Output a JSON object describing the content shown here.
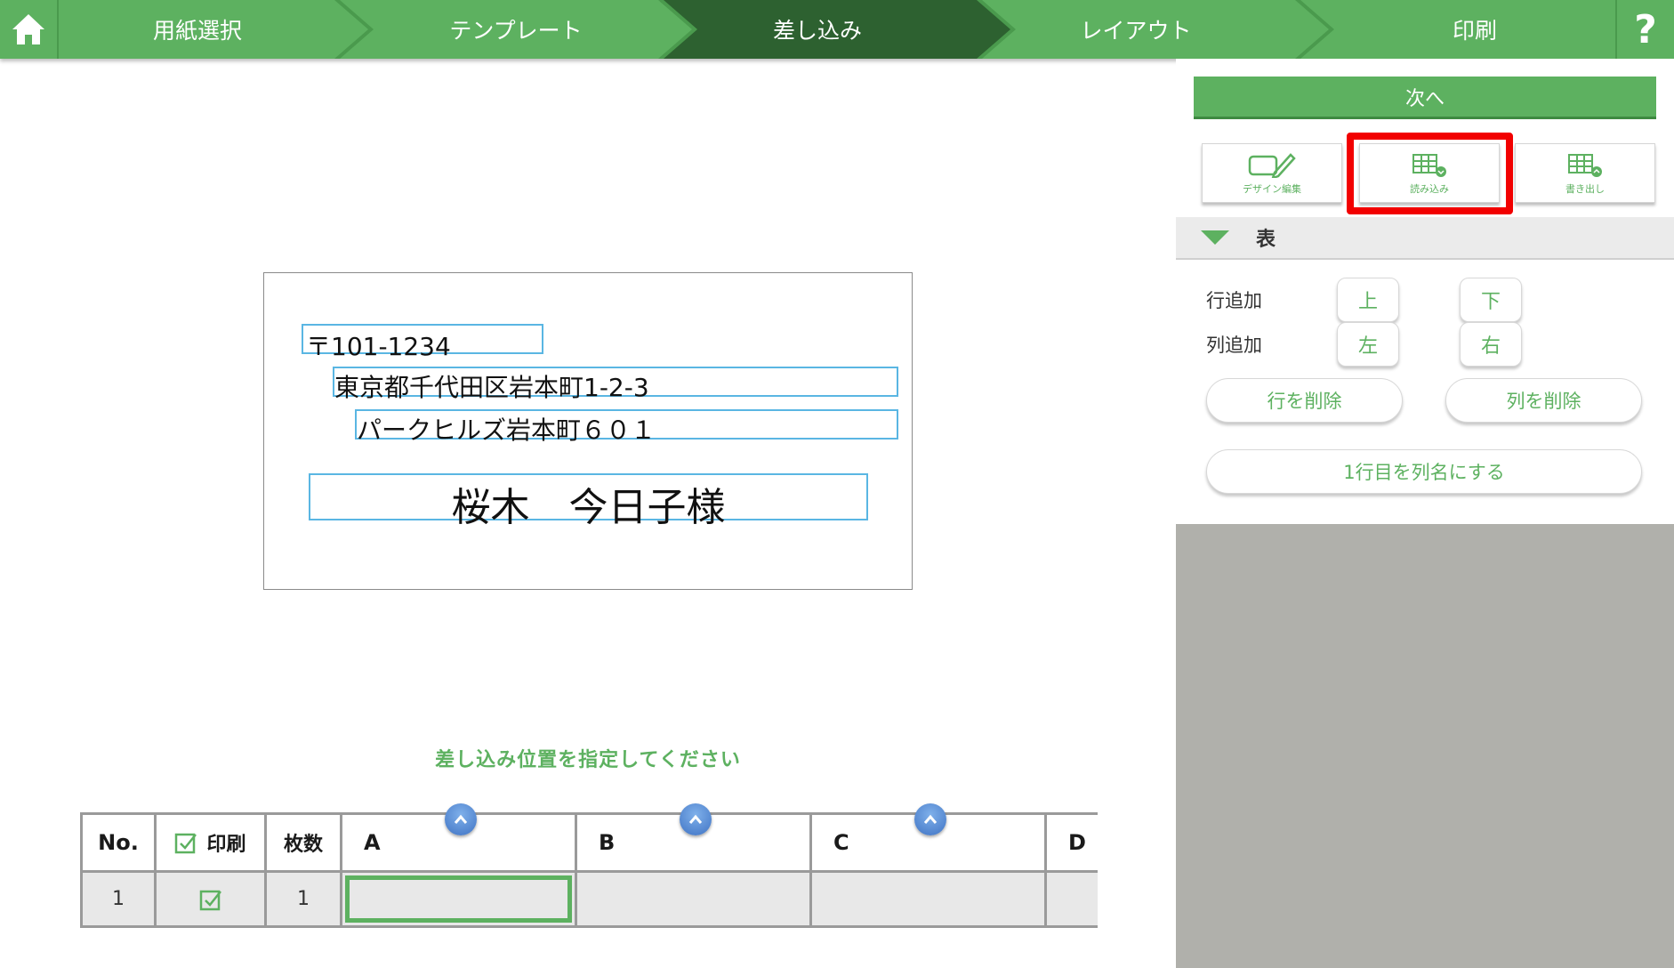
{
  "wizard": {
    "steps": [
      {
        "label": "用紙選択"
      },
      {
        "label": "テンプレート"
      },
      {
        "label": "差し込み",
        "active": true
      },
      {
        "label": "レイアウト"
      },
      {
        "label": "印刷"
      }
    ],
    "help_label": "?"
  },
  "label_preview": {
    "postal": "〒101-1234",
    "address1": "東京都千代田区岩本町1-2-3",
    "address2": "パークヒルズ岩本町６０１",
    "name": "桜木　今日子様"
  },
  "instruction": "差し込み位置を指定してください",
  "grid": {
    "headers": {
      "no": "No.",
      "print": "印刷",
      "count": "枚数",
      "col_a": "A",
      "col_b": "B",
      "col_c": "C",
      "col_d": "D"
    },
    "rows": [
      {
        "no": "1",
        "print_checked": true,
        "count": "1",
        "a": "",
        "b": "",
        "c": "",
        "d": ""
      }
    ]
  },
  "panel": {
    "next_label": "次へ",
    "tools": {
      "design_edit": "デザイン編集",
      "import": "読み込み",
      "export": "書き出し"
    },
    "section_title": "表",
    "add_row_label": "行追加",
    "add_col_label": "列追加",
    "above": "上",
    "below": "下",
    "left": "左",
    "right": "右",
    "delete_row": "行を削除",
    "delete_col": "列を削除",
    "first_row_header": "1行目を列名にする"
  },
  "colors": {
    "brand_green": "#5db160",
    "active_step": "#2d6130",
    "highlight_red": "#f20000",
    "field_border": "#5ab6e3"
  }
}
